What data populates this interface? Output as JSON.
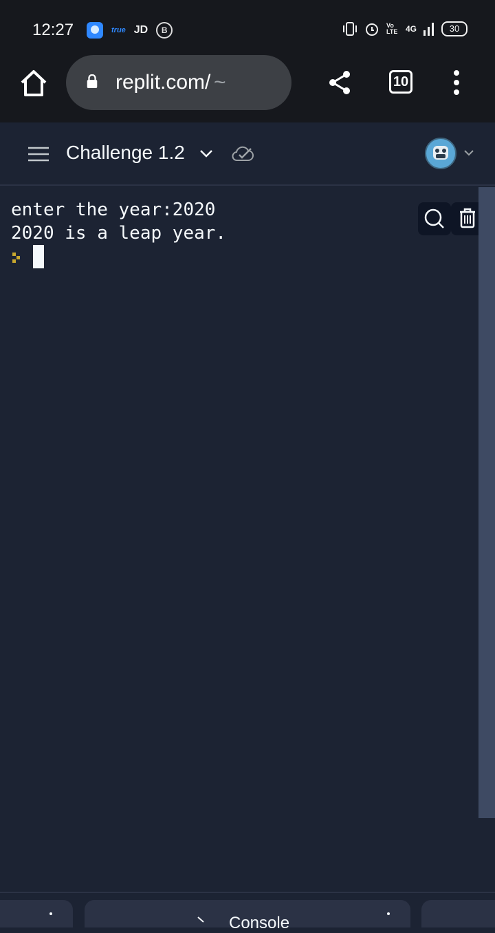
{
  "status_bar": {
    "time": "12:27",
    "carrier_true": "true",
    "carrier_jd": "JD",
    "badge_b": "B",
    "network": "4G",
    "volte": "Vo LTE",
    "battery": "30"
  },
  "browser": {
    "url_host": "replit.com/",
    "url_path": "~",
    "tab_count": "10"
  },
  "header": {
    "project_title": "Challenge 1.2"
  },
  "console": {
    "lines": [
      "enter the year:2020",
      "2020 is a leap year."
    ]
  },
  "bottom_bar": {
    "console_tab": "Console"
  },
  "colors": {
    "background": "#1c2333",
    "status_bg": "#16181d",
    "accent_blue": "#2f88ff",
    "prompt_yellow": "#c7a72e",
    "scrollbar": "#3e4a63"
  }
}
